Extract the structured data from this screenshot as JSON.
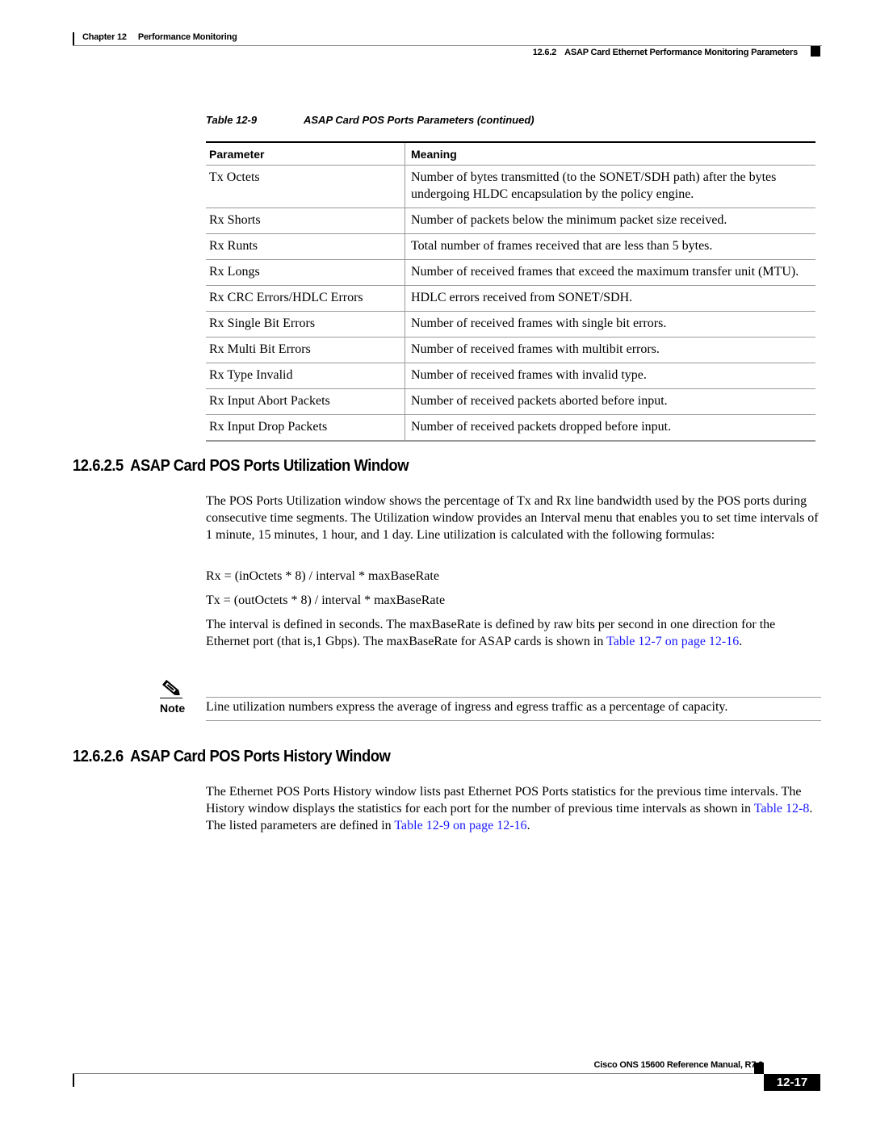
{
  "header": {
    "chapter_label": "Chapter 12",
    "chapter_title": "Performance Monitoring",
    "section_number": "12.6.2",
    "section_title": "ASAP Card Ethernet Performance Monitoring Parameters"
  },
  "table": {
    "caption_label": "Table 12-9",
    "caption_title": "ASAP Card POS Ports Parameters (continued)",
    "columns": [
      "Parameter",
      "Meaning"
    ],
    "rows": [
      {
        "parameter": "Tx Octets",
        "meaning": "Number of bytes transmitted (to the SONET/SDH path) after the bytes undergoing HLDC encapsulation by the policy engine."
      },
      {
        "parameter": "Rx Shorts",
        "meaning": "Number of packets below the minimum packet size received."
      },
      {
        "parameter": "Rx Runts",
        "meaning": "Total number of frames received that are less than 5 bytes."
      },
      {
        "parameter": "Rx Longs",
        "meaning": "Number of received frames that exceed the maximum transfer unit (MTU)."
      },
      {
        "parameter": "Rx CRC Errors/HDLC Errors",
        "meaning": "HDLC errors received from SONET/SDH."
      },
      {
        "parameter": "Rx Single Bit Errors",
        "meaning": "Number of received frames with single bit errors."
      },
      {
        "parameter": "Rx Multi Bit Errors",
        "meaning": "Number of received frames with multibit errors."
      },
      {
        "parameter": "Rx Type Invalid",
        "meaning": "Number of received frames with invalid type."
      },
      {
        "parameter": "Rx Input Abort Packets",
        "meaning": "Number of received packets aborted before input."
      },
      {
        "parameter": "Rx Input Drop Packets",
        "meaning": "Number of received packets dropped before input."
      }
    ]
  },
  "section_utilization": {
    "number": "12.6.2.5",
    "title": "ASAP Card POS Ports Utilization Window",
    "intro": "The POS Ports Utilization window shows the percentage of Tx and Rx line bandwidth used by the POS ports during consecutive time segments. The Utilization window provides an Interval menu that enables you to set time intervals of 1 minute, 15 minutes, 1 hour, and 1 day. Line utilization is calculated with the following formulas:",
    "formula_rx": "Rx = (inOctets * 8) / interval * maxBaseRate",
    "formula_tx": "Tx = (outOctets * 8) / interval * maxBaseRate",
    "interval_text": "The interval is defined in seconds. The maxBaseRate is defined by raw bits per second in one direction for the Ethernet port (that is,1 Gbps). The maxBaseRate for ASAP cards is shown in ",
    "interval_link": "Table 12-7 on page 12-16",
    "interval_end": ".",
    "note_label": "Note",
    "note_text": "Line utilization numbers express the average of ingress and egress traffic as a percentage of capacity."
  },
  "section_history": {
    "number": "12.6.2.6",
    "title": "ASAP Card POS Ports History Window",
    "text_1": "The Ethernet POS Ports History window lists past Ethernet POS Ports statistics for the previous time intervals. The History window displays the statistics for each port for the number of previous time intervals as shown in ",
    "link_1": "Table 12-8",
    "text_2": ". The listed parameters are defined in ",
    "link_2": "Table 12-9 on page 12-16",
    "text_3": "."
  },
  "footer": {
    "manual_title": "Cisco ONS 15600 Reference Manual, R7.2",
    "page_number": "12-17"
  },
  "colors": {
    "link": "#1a1aff",
    "rule": "#999999"
  }
}
